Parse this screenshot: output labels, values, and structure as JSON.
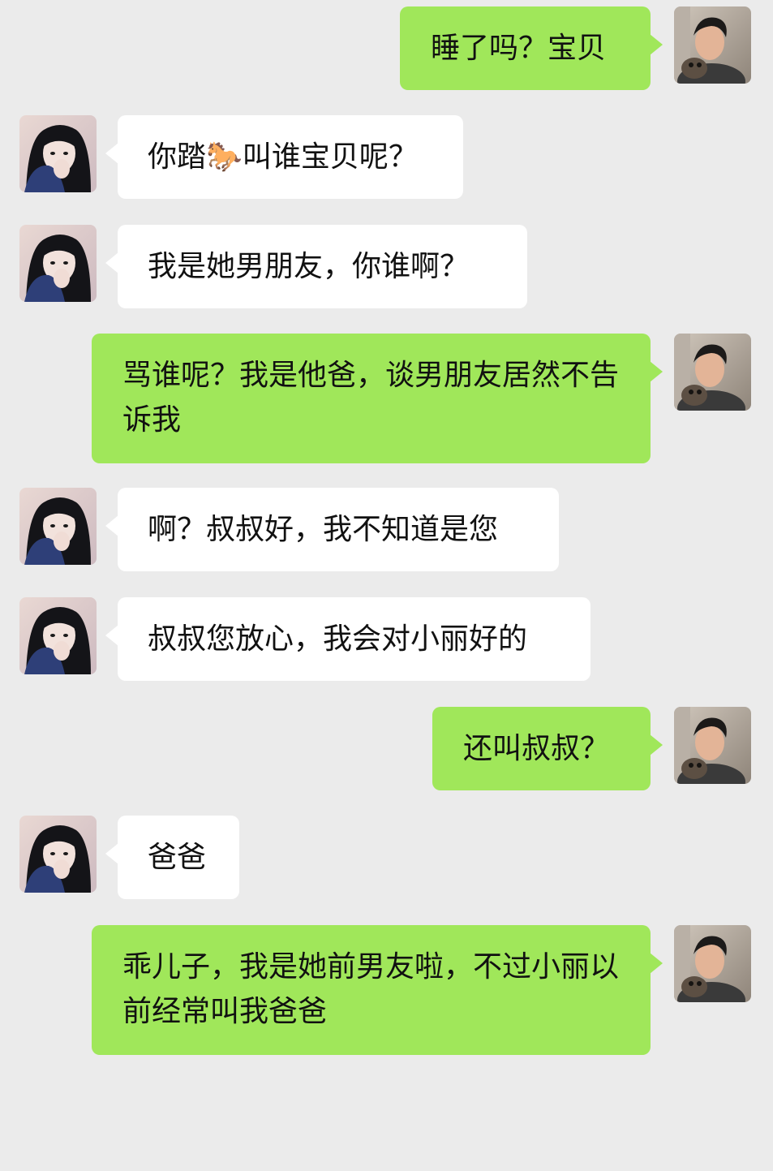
{
  "messages": [
    {
      "sender": "me",
      "text": "睡了吗？宝贝"
    },
    {
      "sender": "her",
      "text": "你踏🐎叫谁宝贝呢？"
    },
    {
      "sender": "her",
      "text": "我是她男朋友，你谁啊？"
    },
    {
      "sender": "me",
      "text": "骂谁呢？我是他爸，谈男朋友居然不告诉我"
    },
    {
      "sender": "her",
      "text": "啊？叔叔好，我不知道是您"
    },
    {
      "sender": "her",
      "text": "叔叔您放心，我会对小丽好的"
    },
    {
      "sender": "me",
      "text": "还叫叔叔？"
    },
    {
      "sender": "her",
      "text": "爸爸"
    },
    {
      "sender": "me",
      "text": "乖儿子，我是她前男友啦，不过小丽以前经常叫我爸爸"
    }
  ],
  "colors": {
    "background": "#ebebeb",
    "sent_bubble": "#a0e75a",
    "received_bubble": "#ffffff",
    "text": "#111111"
  },
  "avatars": {
    "me": "male-avatar-photo",
    "her": "female-avatar-photo"
  }
}
